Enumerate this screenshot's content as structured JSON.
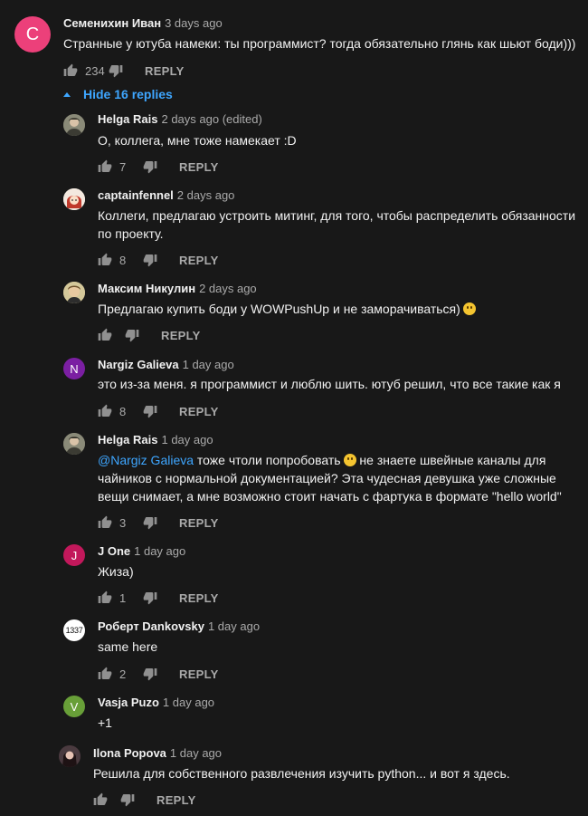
{
  "colors": {
    "background": "#181818",
    "link": "#3ea6ff",
    "text": "#f1f1f1",
    "muted": "#aaaaaa"
  },
  "reply_label": "REPLY",
  "hide_replies_label": "Hide 16 replies",
  "main_comment": {
    "avatar_letter": "С",
    "avatar_color": "#ec407a",
    "author": "Семенихин Иван",
    "time": "3 days ago",
    "text": "Странные у ютуба намеки: ты программист? тогда обязательно глянь как шьют боди)))",
    "likes": "234"
  },
  "replies": [
    {
      "author": "Helga Rais",
      "time": "2 days ago (edited)",
      "text": "О, коллега, мне тоже намекает :D",
      "likes": "7",
      "avatar_icon": "photo-avatar-icon"
    },
    {
      "author": "captainfennel",
      "time": "2 days ago",
      "text": "Коллеги, предлагаю устроить митинг, для того, чтобы распределить обязанности по проекту.",
      "likes": "8",
      "avatar_icon": "anime-avatar-icon"
    },
    {
      "author": "Максим Никулин",
      "time": "2 days ago",
      "text": "Предлагаю купить боди у WOWPushUp и не заморачиваться)",
      "likes": "",
      "avatar_icon": "photo-avatar-icon"
    },
    {
      "author": "Nargiz Galieva",
      "time": "1 day ago",
      "text": "это из-за меня. я программист и люблю шить. ютуб решил, что все такие как я",
      "likes": "8",
      "avatar_letter": "N",
      "avatar_color": "#7b1fa2"
    },
    {
      "author": "Helga Rais",
      "time": "1 day ago",
      "mention": "@Nargiz Galieva",
      "text_line1_rest": " тоже чтоли попробовать",
      "text_line1_tail": " не знаете швейные каналы для",
      "text_line2": "чайников с нормальной документацией? Эта чудесная девушка уже сложные",
      "text_line3": "вещи снимает, а мне возможно стоит начать с фартука в формате \"hello world\"",
      "likes": "3",
      "avatar_icon": "photo-avatar-icon"
    },
    {
      "author": "J One",
      "time": "1 day ago",
      "text": "Жиза)",
      "likes": "1",
      "avatar_letter": "J",
      "avatar_color": "#c2185b"
    },
    {
      "author": "Роберт Dankovsky",
      "time": "1 day ago",
      "text": "same here",
      "likes": "2",
      "avatar_letter": "1337",
      "avatar_color": "#ffffff"
    },
    {
      "author": "Vasja Puzo",
      "time": "1 day ago",
      "text": "+1",
      "likes": "",
      "avatar_letter": "V",
      "avatar_color": "#689f38"
    },
    {
      "author": "Ilona Popova",
      "time": "1 day ago",
      "text": "Решила для собственного развлечения изучить python... и вот я здесь.",
      "likes": "",
      "avatar_icon": "photo-avatar-icon"
    }
  ]
}
